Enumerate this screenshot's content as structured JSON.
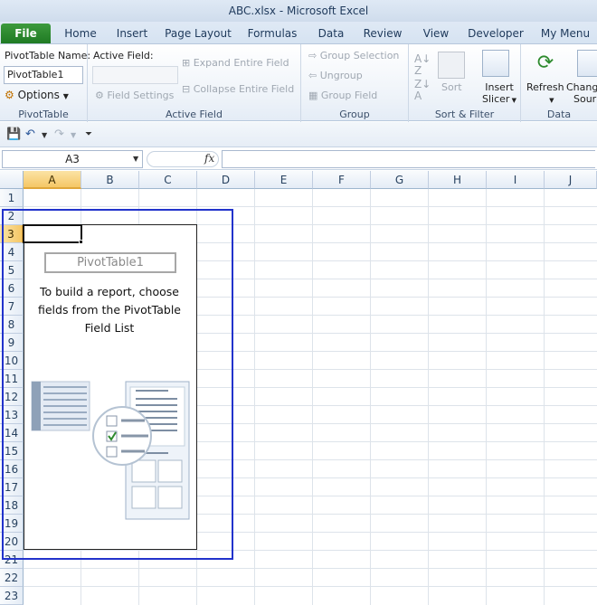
{
  "window": {
    "title": "ABC.xlsx  -  Microsoft Excel"
  },
  "tabs": [
    "File",
    "Home",
    "Insert",
    "Page Layout",
    "Formulas",
    "Data",
    "Review",
    "View",
    "Developer",
    "My Menu"
  ],
  "ribbon": {
    "pivottable_group": {
      "name_label": "PivotTable Name:",
      "name_value": "PivotTable1",
      "options_label": "Options",
      "group_label": "PivotTable"
    },
    "active_field_group": {
      "label": "Active Field:",
      "field_settings": "Field Settings",
      "expand": "Expand Entire Field",
      "collapse": "Collapse Entire Field",
      "group_label": "Active Field"
    },
    "group_group": {
      "group_selection": "Group Selection",
      "ungroup": "Ungroup",
      "group_field": "Group Field",
      "group_label": "Group"
    },
    "sort_filter_group": {
      "sort": "Sort",
      "insert_slicer_line1": "Insert",
      "insert_slicer_line2": "Slicer",
      "group_label": "Sort & Filter"
    },
    "data_group": {
      "refresh": "Refresh",
      "change_line1": "Chang",
      "change_line2": "Sour",
      "group_label": "Data"
    }
  },
  "formula_bar": {
    "name_box": "A3",
    "fx": "fx",
    "formula": ""
  },
  "grid": {
    "columns": [
      "A",
      "B",
      "C",
      "D",
      "E",
      "F",
      "G",
      "H",
      "I",
      "J"
    ],
    "rows": [
      "1",
      "2",
      "3",
      "4",
      "5",
      "6",
      "7",
      "8",
      "9",
      "10",
      "11",
      "12",
      "13",
      "14",
      "15",
      "16",
      "17",
      "18",
      "19",
      "20",
      "21",
      "22",
      "23"
    ],
    "active_column": "A",
    "active_row": "3"
  },
  "pivot": {
    "name": "PivotTable1",
    "instruction_line1": "To build a report, choose",
    "instruction_line2": "fields from the PivotTable",
    "instruction_line3": "Field List"
  },
  "colors": {
    "selection_border": "#2233cc",
    "file_tab": "#1f7a23",
    "active_header": "#f5c766"
  }
}
